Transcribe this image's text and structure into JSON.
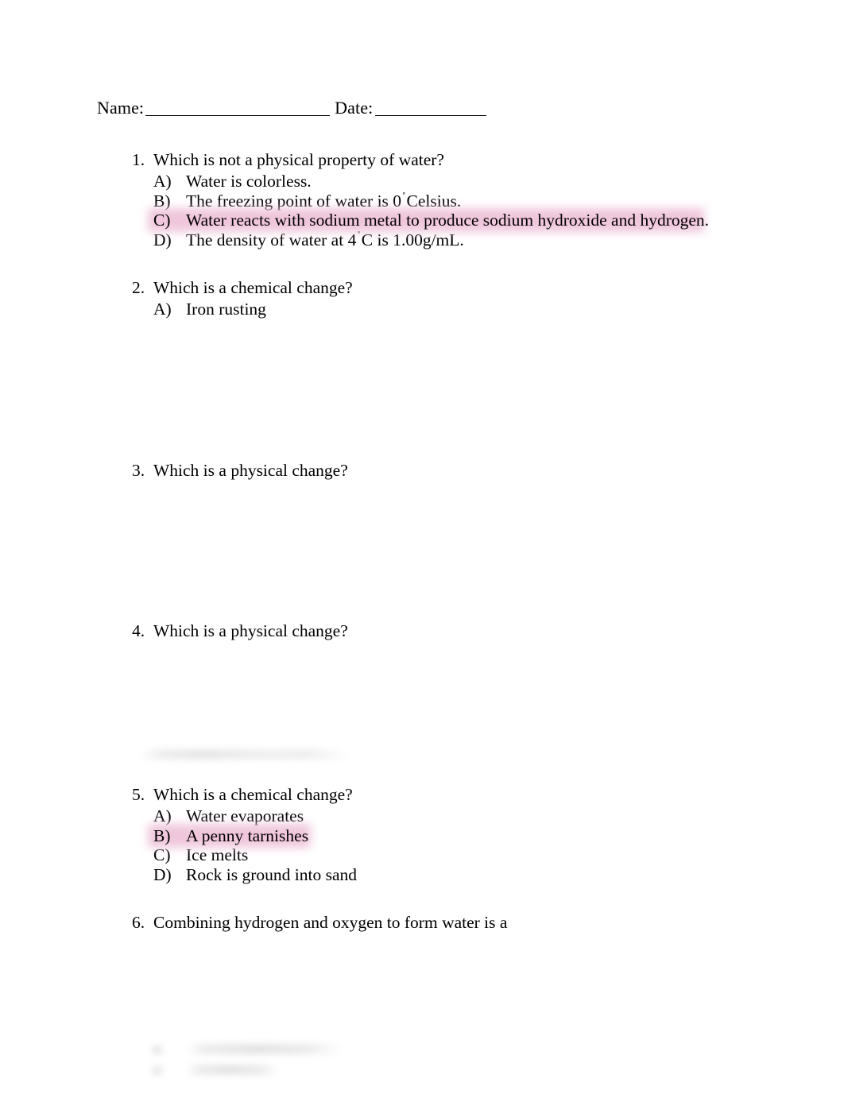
{
  "document": {
    "title": "Chemistry Worksheet - Physical and Chemical Changes",
    "header": {
      "name_label": "Name:",
      "date_label": "Date:",
      "name_value": "",
      "date_value": "",
      "name_placeholder": "",
      "date_placeholder": ""
    },
    "highlight_color": "#eec2d9",
    "text_color": "#000000",
    "page_background": "#ffffff"
  },
  "questions": [
    {
      "number": "1.",
      "text": "Which is not a physical property of water?",
      "options": [
        {
          "letter": "A)",
          "text": "Water is colorless.",
          "highlighted": false
        },
        {
          "letter": "B)",
          "text_before": "The freezing point of water is 0",
          "degree": "˚",
          "text_after": "Celsius.",
          "highlighted": false
        },
        {
          "letter": "C)",
          "text": "Water reacts with sodium metal to produce sodium hydroxide and hydrogen.",
          "highlighted": true
        },
        {
          "letter": "D)",
          "text_before": "The density of water at 4",
          "degree": "˚",
          "text_after": "C is 1.00g/mL.",
          "highlighted": false
        }
      ]
    },
    {
      "number": "2.",
      "text": "Which is a chemical change?",
      "options": [
        {
          "letter": "A)",
          "text": "Iron rusting",
          "highlighted": false
        }
      ]
    },
    {
      "number": "3.",
      "text": "Which is a physical change?",
      "options": []
    },
    {
      "number": "4.",
      "text": "Which is a physical change?",
      "options": []
    },
    {
      "number": "5.",
      "text": "Which is a chemical change?",
      "options": [
        {
          "letter": "A)",
          "text": "Water evaporates",
          "highlighted": false
        },
        {
          "letter": "B)",
          "text": "A penny tarnishes",
          "highlighted": true
        },
        {
          "letter": "C)",
          "text": "Ice melts",
          "highlighted": false
        },
        {
          "letter": "D)",
          "text": "Rock is ground into sand",
          "highlighted": false
        }
      ]
    },
    {
      "number": "6.",
      "text": "Combining hydrogen and oxygen to form water is a",
      "options": []
    }
  ],
  "obscured": {
    "erased_line_note": "",
    "blurred_options": [
      {
        "letter": "",
        "text": ""
      },
      {
        "letter": "",
        "text": ""
      }
    ]
  }
}
